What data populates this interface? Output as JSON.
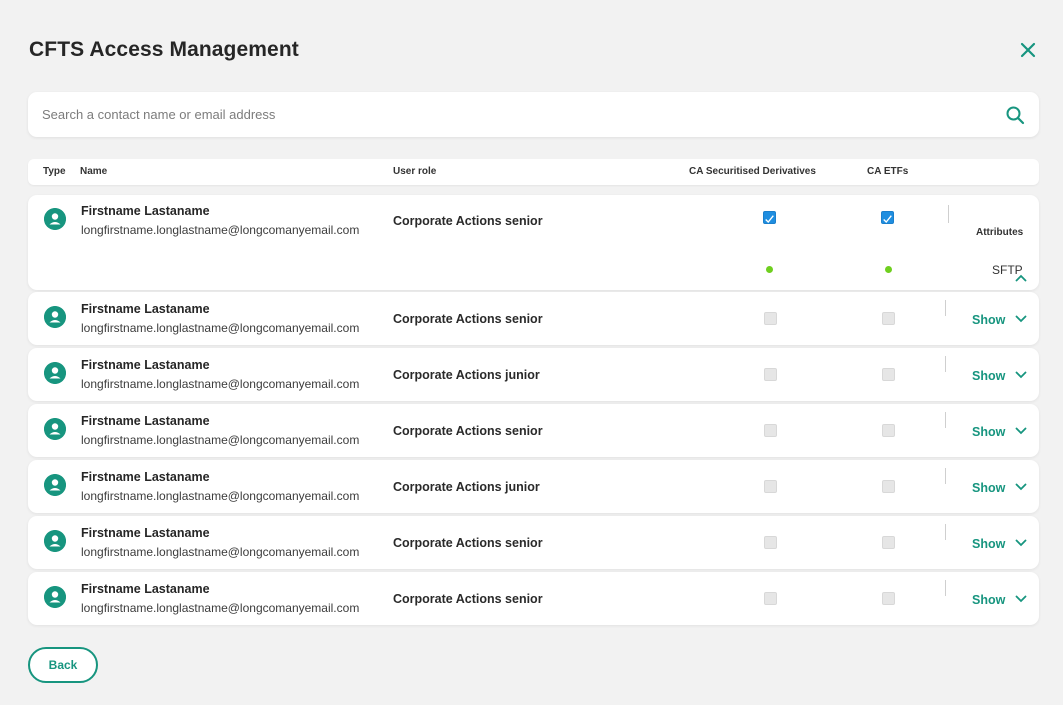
{
  "title": "CFTS Access Management",
  "search": {
    "placeholder": "Search a contact name or email address"
  },
  "columns": {
    "type": "Type",
    "name": "Name",
    "role": "User role",
    "ca_sd": "CA Securitised Derivatives",
    "ca_etfs": "CA ETFs"
  },
  "rows": [
    {
      "name": "Firstname Lastaname",
      "email": "longfirstname.longlastname@longcomanyemail.com",
      "role": "Corporate Actions senior",
      "ca_sd": true,
      "ca_etfs": true,
      "expanded": true,
      "attributes_label": "Attributes",
      "attribute_value": "SFTP"
    },
    {
      "name": "Firstname Lastaname",
      "email": "longfirstname.longlastname@longcomanyemail.com",
      "role": "Corporate Actions senior",
      "ca_sd": false,
      "ca_etfs": false,
      "show_label": "Show"
    },
    {
      "name": "Firstname Lastaname",
      "email": "longfirstname.longlastname@longcomanyemail.com",
      "role": "Corporate Actions junior",
      "ca_sd": false,
      "ca_etfs": false,
      "show_label": "Show"
    },
    {
      "name": "Firstname Lastaname",
      "email": "longfirstname.longlastname@longcomanyemail.com",
      "role": "Corporate Actions senior",
      "ca_sd": false,
      "ca_etfs": false,
      "show_label": "Show"
    },
    {
      "name": "Firstname Lastaname",
      "email": "longfirstname.longlastname@longcomanyemail.com",
      "role": "Corporate Actions junior",
      "ca_sd": false,
      "ca_etfs": false,
      "show_label": "Show"
    },
    {
      "name": "Firstname Lastaname",
      "email": "longfirstname.longlastname@longcomanyemail.com",
      "role": "Corporate Actions senior",
      "ca_sd": false,
      "ca_etfs": false,
      "show_label": "Show"
    },
    {
      "name": "Firstname Lastaname",
      "email": "longfirstname.longlastname@longcomanyemail.com",
      "role": "Corporate Actions senior",
      "ca_sd": false,
      "ca_etfs": false,
      "show_label": "Show"
    }
  ],
  "back_label": "Back",
  "colors": {
    "accent": "#17957f",
    "checkbox_checked": "#1f8ee0",
    "status_dot": "#6fcf1f"
  }
}
